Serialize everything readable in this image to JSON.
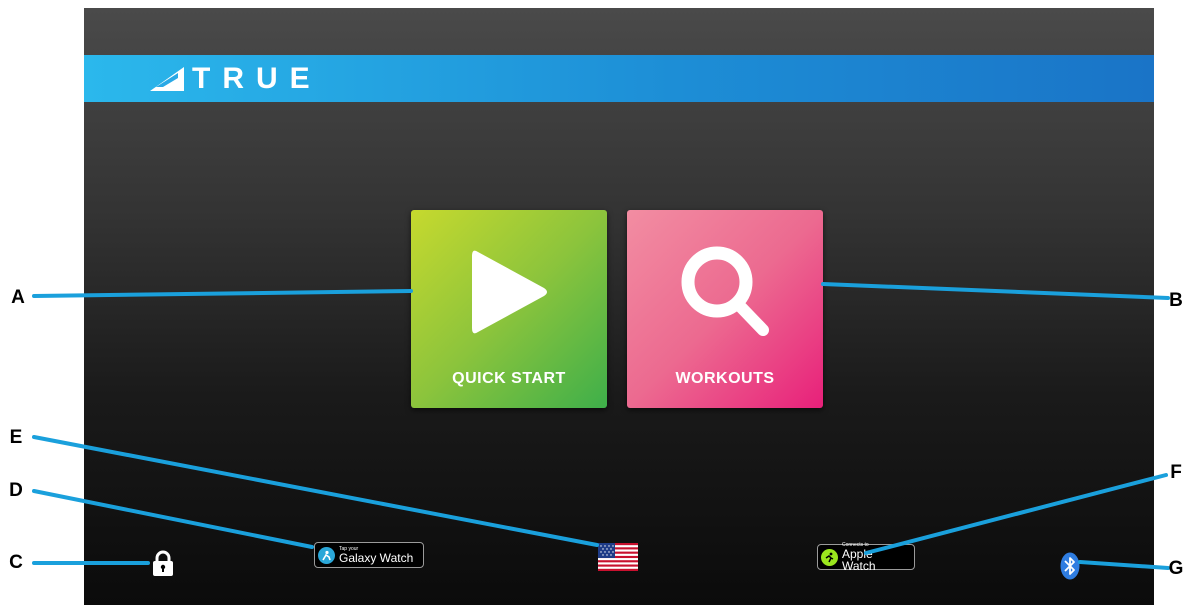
{
  "header": {
    "brand_name": "TRUE",
    "logo_icon": "true-logo-triangle-icon",
    "bar_color": "#2196de"
  },
  "tiles": {
    "quick_start": {
      "label": "QUICK START",
      "icon": "play-icon",
      "color": "#8cc43c"
    },
    "workouts": {
      "label": "WORKOUTS",
      "icon": "search-icon",
      "color": "#ec4f86"
    }
  },
  "footer": {
    "lock_icon": "lock-icon",
    "galaxy_watch": {
      "small_text": "Tap your",
      "main_text": "Galaxy Watch",
      "icon": "samsung-health-icon"
    },
    "language_flag": "us-flag-icon",
    "apple_watch": {
      "small_text": "Connects to",
      "main_text": "Apple Watch",
      "icon": "apple-fitness-icon"
    },
    "bluetooth_icon": "bluetooth-icon"
  },
  "callouts": {
    "a": "A",
    "b": "B",
    "c": "C",
    "d": "D",
    "e": "E",
    "f": "F",
    "g": "G",
    "line_color": "#1aa0dc"
  }
}
